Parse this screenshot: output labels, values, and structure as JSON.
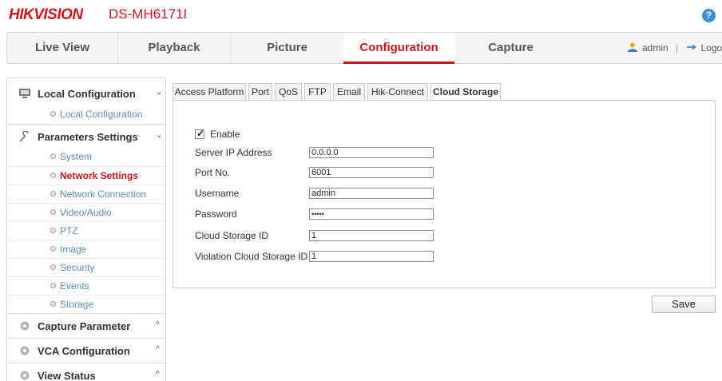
{
  "header": {
    "brand": "HIKVISION",
    "model": "DS-MH6171I",
    "help_glyph": "?"
  },
  "nav": {
    "tabs": [
      "Live View",
      "Playback",
      "Picture",
      "Configuration",
      "Capture"
    ],
    "active": "Configuration",
    "user": "admin",
    "separator": "|",
    "logout": "Logout"
  },
  "sidebar": {
    "local_configuration": {
      "label": "Local Configuration",
      "items": [
        "Local Configuration"
      ]
    },
    "parameters_settings": {
      "label": "Parameters Settings",
      "items": [
        "System",
        "Network Settings",
        "Network Connection",
        "Video/Audio",
        "PTZ",
        "Image",
        "Security",
        "Events",
        "Storage"
      ],
      "active_item": "Network Settings"
    },
    "capture_parameter": {
      "label": "Capture Parameter"
    },
    "vca_configuration": {
      "label": "VCA Configuration"
    },
    "view_status": {
      "label": "View Status"
    },
    "chevron_down": "⌄",
    "chevron_up": "^"
  },
  "subtabs": {
    "items": [
      "Access Platform",
      "Port",
      "QoS",
      "FTP",
      "Email",
      "Hik-Connect",
      "Cloud Storage"
    ],
    "active": "Cloud Storage"
  },
  "form": {
    "enable_label": "Enable",
    "enable_checked": true,
    "check_mark": "✓",
    "server_ip_label": "Server IP Address",
    "server_ip_value": "0.0.0.0",
    "port_label": "Port No.",
    "port_value": "6001",
    "username_label": "Username",
    "username_value": "admin",
    "password_label": "Password",
    "password_value": "•••••",
    "cloud_id_label": "Cloud Storage ID",
    "cloud_id_value": "1",
    "violation_id_label": "Violation Cloud Storage ID",
    "violation_id_value": "1"
  },
  "save_label": "Save",
  "colors": {
    "brand_red": "#c8161d",
    "link_blue": "#5e8fbf",
    "help_blue": "#3c8fd0"
  }
}
